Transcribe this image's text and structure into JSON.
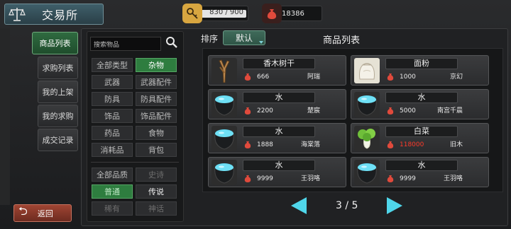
{
  "header": {
    "title": "交易所"
  },
  "resources": {
    "stamina": {
      "value": "830 / 900",
      "fill_fraction": 0.92
    },
    "gold": {
      "value": "18386"
    }
  },
  "nav": {
    "items": [
      {
        "label": "商品列表"
      },
      {
        "label": "求购列表"
      },
      {
        "label": "我的上架"
      },
      {
        "label": "我的求购"
      },
      {
        "label": "成交记录"
      }
    ],
    "back_label": "返回"
  },
  "filters": {
    "search_placeholder": "搜索物品",
    "types": [
      "全部类型",
      "杂物",
      "武器",
      "武器配件",
      "防具",
      "防具配件",
      "饰品",
      "饰品配件",
      "药品",
      "食物",
      "消耗品",
      "背包"
    ],
    "qualities": [
      "全部品质",
      "史诗",
      "普通",
      "传说",
      "稀有",
      "神话"
    ]
  },
  "list": {
    "sort_label": "排序",
    "sort_value": "默认",
    "title": "商品列表",
    "items": [
      {
        "name": "香木树干",
        "price": "666",
        "seller": "阿瑞",
        "img": "wood-icon"
      },
      {
        "name": "面粉",
        "price": "1000",
        "seller": "京幻",
        "img": "flour-icon"
      },
      {
        "name": "水",
        "price": "2200",
        "seller": "楚宸",
        "img": "water-pot-icon"
      },
      {
        "name": "水",
        "price": "5000",
        "seller": "南宫千晨",
        "img": "water-pot-icon"
      },
      {
        "name": "水",
        "price": "1888",
        "seller": "海棠落",
        "img": "water-pot-icon"
      },
      {
        "name": "白菜",
        "price": "118000",
        "seller": "旧木",
        "img": "cabbage-icon",
        "price_color": "#ff3a2a"
      },
      {
        "name": "水",
        "price": "9999",
        "seller": "王羽咯",
        "img": "water-pot-icon"
      },
      {
        "name": "水",
        "price": "9999",
        "seller": "王羽咯",
        "img": "water-pot-icon"
      }
    ]
  },
  "pagination": {
    "text": "3 / 5"
  }
}
